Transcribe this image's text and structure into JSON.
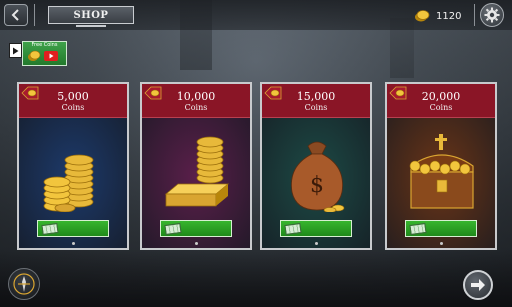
{
  "header": {
    "title": "SHOP",
    "balance": "1120"
  },
  "free_coins": {
    "label": "Free Coins"
  },
  "packages": [
    {
      "amount": "5,000",
      "unit": "Coins",
      "header_color": "#8a1526",
      "body_color": "#1d3a6b",
      "art": "coin-stack-icon"
    },
    {
      "amount": "10,000",
      "unit": "Coins",
      "header_color": "#8a1526",
      "body_color": "#5a1f4a",
      "art": "gold-bars-icon"
    },
    {
      "amount": "15,000",
      "unit": "Coins",
      "header_color": "#8a1526",
      "body_color": "#1d4a45",
      "art": "money-bag-icon"
    },
    {
      "amount": "20,000",
      "unit": "Coins",
      "header_color": "#8a1526",
      "body_color": "#6b3517",
      "art": "treasure-chest-icon"
    }
  ],
  "colors": {
    "accent_gold": "#e8b93a",
    "buy_green": "#2aa125",
    "card_header": "#8a1526"
  }
}
